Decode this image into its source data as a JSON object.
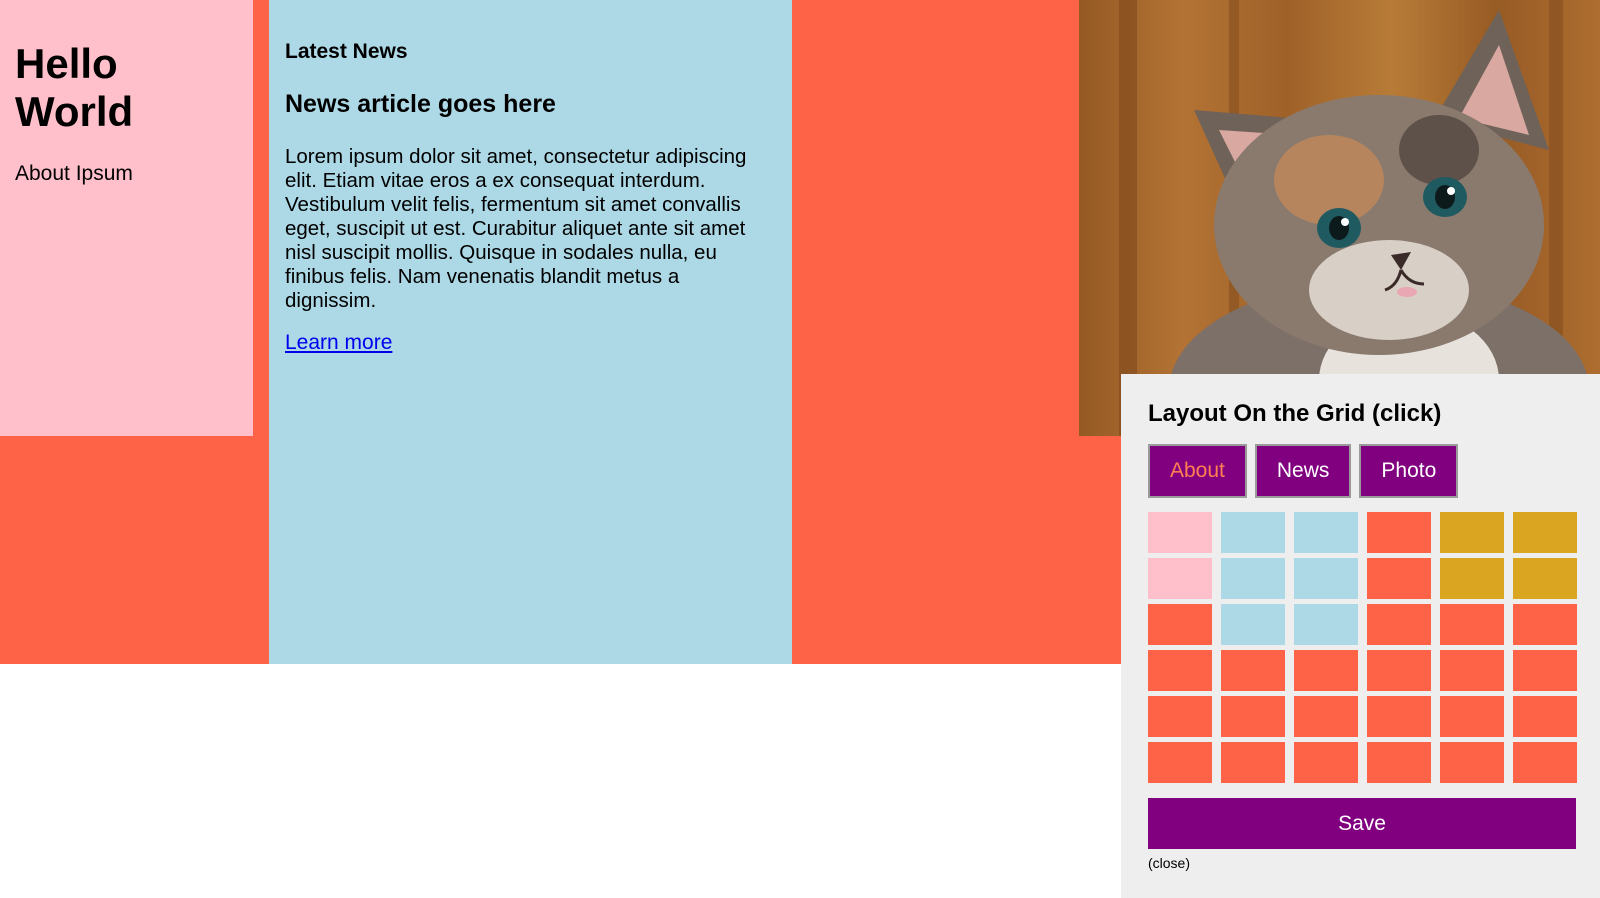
{
  "about": {
    "title": "Hello World",
    "text": "About Ipsum"
  },
  "news": {
    "section_heading": "Latest News",
    "article_title": "News article goes here",
    "body": "Lorem ipsum dolor sit amet, consectetur adipiscing elit. Etiam vitae eros a ex consequat interdum. Vestibulum velit felis, fermentum sit amet convallis eget, suscipit ut est. Curabitur aliquet ante sit amet nisl suscipit mollis. Quisque in sodales nulla, eu finibus felis. Nam venenatis blandit metus a dignissim.",
    "link_text": "Learn more"
  },
  "photo": {
    "subject": "kitten-photo"
  },
  "layout_panel": {
    "title": "Layout On the Grid (click)",
    "tabs": [
      {
        "label": "About",
        "active": true
      },
      {
        "label": "News",
        "active": false
      },
      {
        "label": "Photo",
        "active": false
      }
    ],
    "grid_rows": [
      [
        "#ffc0cb",
        "#add8e6",
        "#add8e6",
        "#ff6347",
        "#daa520",
        "#daa520"
      ],
      [
        "#ffc0cb",
        "#add8e6",
        "#add8e6",
        "#ff6347",
        "#daa520",
        "#daa520"
      ],
      [
        "#ff6347",
        "#add8e6",
        "#add8e6",
        "#ff6347",
        "#ff6347",
        "#ff6347"
      ],
      [
        "#ff6347",
        "#ff6347",
        "#ff6347",
        "#ff6347",
        "#ff6347",
        "#ff6347"
      ],
      [
        "#ff6347",
        "#ff6347",
        "#ff6347",
        "#ff6347",
        "#ff6347",
        "#ff6347"
      ],
      [
        "#ff6347",
        "#ff6347",
        "#ff6347",
        "#ff6347",
        "#ff6347",
        "#ff6347"
      ]
    ],
    "save_label": "Save",
    "close_label": "(close)"
  },
  "colors": {
    "tomato": "#ff6347",
    "pink": "#ffc0cb",
    "lightblue": "#add8e6",
    "goldenrod": "#daa520",
    "purple": "#800080",
    "coral": "#ff7f50"
  }
}
